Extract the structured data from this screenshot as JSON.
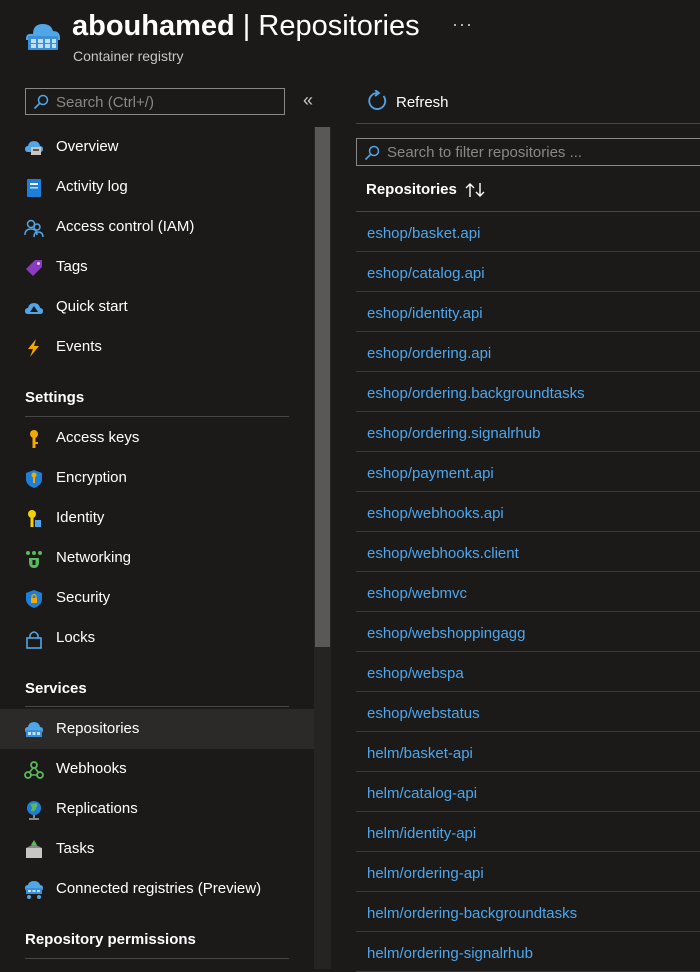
{
  "header": {
    "resource_name": "abouhamed",
    "separator": " | ",
    "page_title": "Repositories",
    "resource_type": "Container registry",
    "more_label": "···"
  },
  "sidebar": {
    "search_placeholder": "Search (Ctrl+/)",
    "collapse_label": "«",
    "items_top": [
      {
        "label": "Overview",
        "icon": "overview-cloud-icon"
      },
      {
        "label": "Activity log",
        "icon": "activity-log-icon"
      },
      {
        "label": "Access control (IAM)",
        "icon": "people-icon"
      },
      {
        "label": "Tags",
        "icon": "tag-icon"
      },
      {
        "label": "Quick start",
        "icon": "quickstart-cloud-icon"
      },
      {
        "label": "Events",
        "icon": "lightning-icon"
      }
    ],
    "settings_header": "Settings",
    "settings_items": [
      {
        "label": "Access keys",
        "icon": "key-icon"
      },
      {
        "label": "Encryption",
        "icon": "shield-icon"
      },
      {
        "label": "Identity",
        "icon": "identity-key-icon"
      },
      {
        "label": "Networking",
        "icon": "networking-icon"
      },
      {
        "label": "Security",
        "icon": "security-shield-icon"
      },
      {
        "label": "Locks",
        "icon": "lock-icon"
      }
    ],
    "services_header": "Services",
    "services_items": [
      {
        "label": "Repositories",
        "icon": "repositories-cloud-icon",
        "active": true
      },
      {
        "label": "Webhooks",
        "icon": "webhook-icon"
      },
      {
        "label": "Replications",
        "icon": "globe-icon"
      },
      {
        "label": "Tasks",
        "icon": "tasks-icon"
      },
      {
        "label": "Connected registries (Preview)",
        "icon": "connected-registries-icon"
      }
    ],
    "permissions_header": "Repository permissions"
  },
  "toolbar": {
    "refresh_label": "Refresh"
  },
  "content": {
    "filter_placeholder": "Search to filter repositories ...",
    "column_header": "Repositories",
    "repositories": [
      "eshop/basket.api",
      "eshop/catalog.api",
      "eshop/identity.api",
      "eshop/ordering.api",
      "eshop/ordering.backgroundtasks",
      "eshop/ordering.signalrhub",
      "eshop/payment.api",
      "eshop/webhooks.api",
      "eshop/webhooks.client",
      "eshop/webmvc",
      "eshop/webshoppingagg",
      "eshop/webspa",
      "eshop/webstatus",
      "helm/basket-api",
      "helm/catalog-api",
      "helm/identity-api",
      "helm/ordering-api",
      "helm/ordering-backgroundtasks",
      "helm/ordering-signalrhub"
    ]
  },
  "colors": {
    "background": "#1b1a19",
    "link": "#4ea6ec",
    "accent": "#0078d4"
  }
}
